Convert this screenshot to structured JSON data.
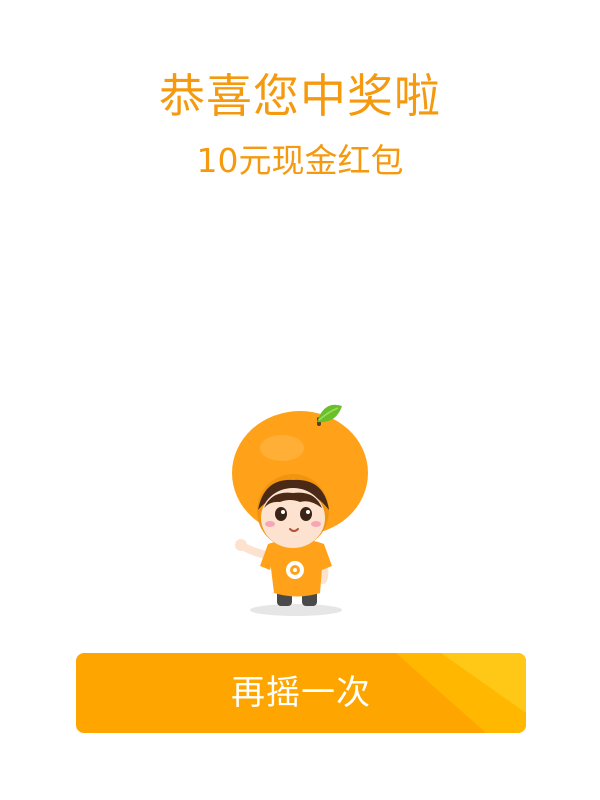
{
  "prize": {
    "title": "恭喜您中奖啦",
    "subtitle": "10元现金红包"
  },
  "mascot": {
    "icon": "orange-mascot-icon",
    "colors": {
      "body": "#ffa21a",
      "leaf": "#6abf2d",
      "skin": "#fde2d0",
      "hair": "#4a2a17"
    }
  },
  "button": {
    "label": "再摇一次"
  },
  "colors": {
    "accent": "#f59a0f",
    "button": "#ffa500",
    "button_highlight": "#ffbf00",
    "background": "#ffffff"
  }
}
